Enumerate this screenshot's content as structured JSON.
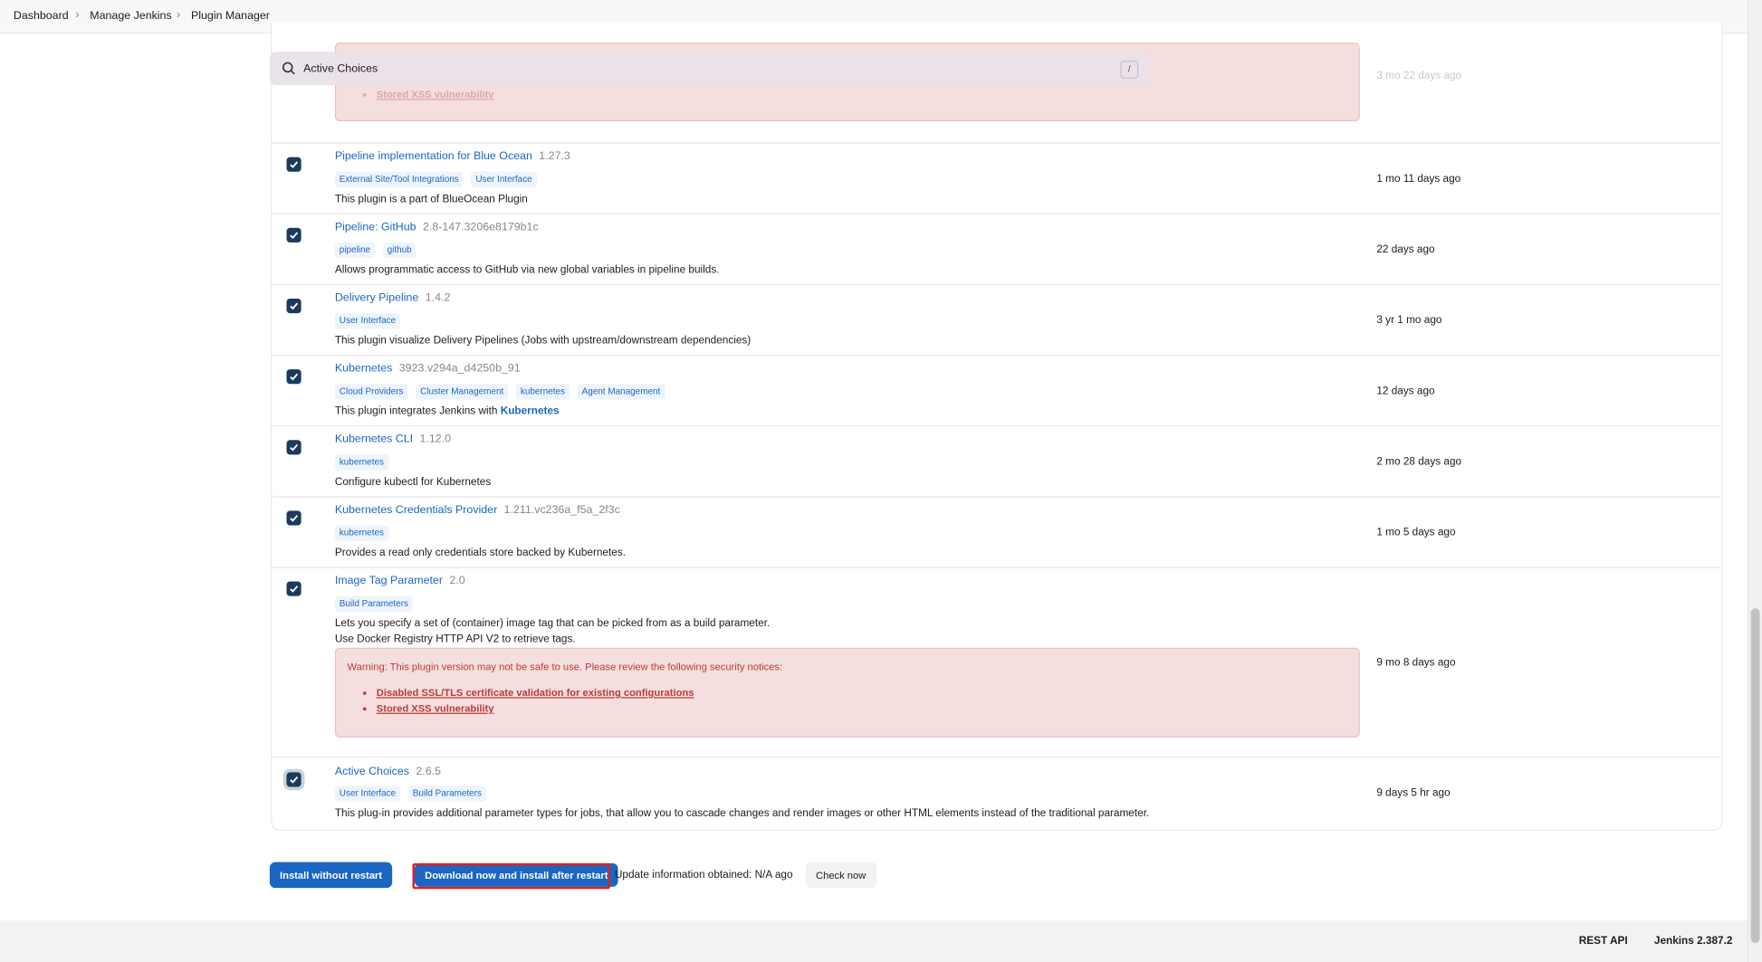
{
  "breadcrumb": [
    "Dashboard",
    "Manage Jenkins",
    "Plugin Manager"
  ],
  "search": {
    "value": "Active Choices",
    "shortcut": "/"
  },
  "top_partial": {
    "link": "Stored XSS vulnerability",
    "released": "3 mo 22 days ago"
  },
  "plugins": [
    {
      "name": "Pipeline implementation for Blue Ocean",
      "version": "1.27.3",
      "tags": [
        "External Site/Tool Integrations",
        "User Interface"
      ],
      "description": "This plugin is a part of BlueOcean Plugin",
      "released": "1 mo 11 days ago"
    },
    {
      "name": "Pipeline: GitHub",
      "version": "2.8-147.3206e8179b1c",
      "tags": [
        "pipeline",
        "github"
      ],
      "description": "Allows programmatic access to GitHub via new global variables in pipeline builds.",
      "released": "22 days ago"
    },
    {
      "name": "Delivery Pipeline",
      "version": "1.4.2",
      "tags": [
        "User Interface"
      ],
      "description": "This plugin visualize Delivery Pipelines (Jobs with upstream/downstream dependencies)",
      "released": "3 yr 1 mo ago"
    },
    {
      "name": "Kubernetes",
      "version": "3923.v294a_d4250b_91",
      "tags": [
        "Cloud Providers",
        "Cluster Management",
        "kubernetes",
        "Agent Management"
      ],
      "description": "This plugin integrates Jenkins with",
      "description_link": "Kubernetes",
      "released": "12 days ago"
    },
    {
      "name": "Kubernetes CLI",
      "version": "1.12.0",
      "tags": [
        "kubernetes"
      ],
      "description": "Configure kubectl for Kubernetes",
      "released": "2 mo 28 days ago"
    },
    {
      "name": "Kubernetes Credentials Provider",
      "version": "1.211.vc236a_f5a_2f3c",
      "tags": [
        "kubernetes"
      ],
      "description": "Provides a read only credentials store backed by Kubernetes.",
      "released": "1 mo 5 days ago"
    },
    {
      "name": "Image Tag Parameter",
      "version": "2.0",
      "tags": [
        "Build Parameters"
      ],
      "description": "Lets you specify a set of (container) image tag that can be picked from as a build parameter.",
      "description_line2": "Use Docker Registry HTTP API V2 to retrieve tags.",
      "warning": {
        "title": "Warning: This plugin version may not be safe to use. Please review the following security notices:",
        "links": [
          "Disabled SSL/TLS certificate validation for existing configurations",
          "Stored XSS vulnerability"
        ]
      },
      "released": "9 mo 8 days ago"
    },
    {
      "name": "Active Choices",
      "version": "2.6.5",
      "tags": [
        "User Interface",
        "Build Parameters"
      ],
      "description": "This plug-in provides additional parameter types for jobs, that allow you to cascade changes and render images or other HTML elements instead of the traditional parameter.",
      "released": "9 days 5 hr ago"
    }
  ],
  "actions": {
    "install_without_restart": "Install without restart",
    "download_after_restart": "Download now and install after restart",
    "update_info": "Update information obtained: N/A ago",
    "check_now": "Check now"
  },
  "footer": {
    "rest_api": "REST API",
    "version": "Jenkins 2.387.2"
  },
  "colors": {
    "link": "#1a66c2",
    "checkbox": "#1a3b5d",
    "warning_bg": "#f4dede",
    "warning_text": "#b73c3c",
    "highlight": "#e02020"
  }
}
